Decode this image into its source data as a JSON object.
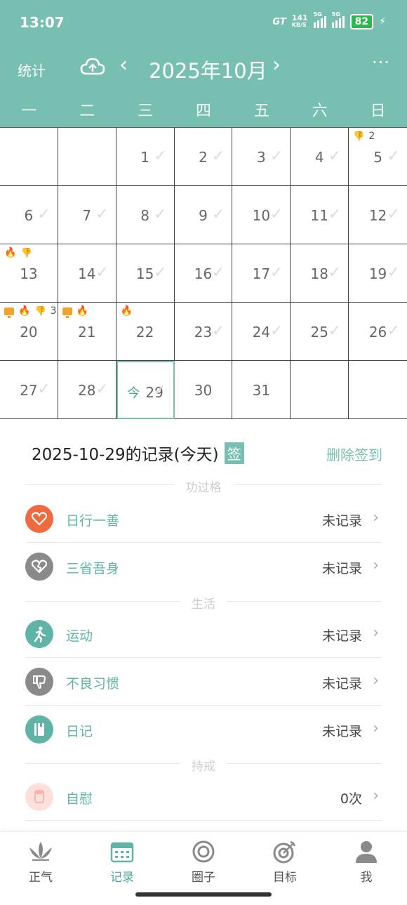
{
  "status_bar": {
    "time": "13:07",
    "carrier": "GT",
    "speed": "141",
    "speed_unit": "KB/S",
    "net1": "5G",
    "net2": "5G",
    "battery": "82"
  },
  "nav": {
    "stats_label": "统计",
    "month_title": "2025年10月",
    "prev": "‹",
    "next": "›",
    "more": "···"
  },
  "weekdays": [
    "一",
    "二",
    "三",
    "四",
    "五",
    "六",
    "日"
  ],
  "calendar": {
    "cells": [
      {
        "day": "",
        "check": false
      },
      {
        "day": "",
        "check": false
      },
      {
        "day": "1",
        "check": true
      },
      {
        "day": "2",
        "check": true
      },
      {
        "day": "3",
        "check": true
      },
      {
        "day": "4",
        "check": true
      },
      {
        "day": "5",
        "check": true,
        "markers": [
          "thumb"
        ],
        "count": "2"
      },
      {
        "day": "6",
        "check": true
      },
      {
        "day": "7",
        "check": true
      },
      {
        "day": "8",
        "check": true
      },
      {
        "day": "9",
        "check": true
      },
      {
        "day": "10",
        "check": true
      },
      {
        "day": "11",
        "check": true
      },
      {
        "day": "12",
        "check": true
      },
      {
        "day": "13",
        "check": false,
        "markers": [
          "fire",
          "thumb"
        ]
      },
      {
        "day": "14",
        "check": true
      },
      {
        "day": "15",
        "check": true
      },
      {
        "day": "16",
        "check": true
      },
      {
        "day": "17",
        "check": true
      },
      {
        "day": "18",
        "check": true
      },
      {
        "day": "19",
        "check": true
      },
      {
        "day": "20",
        "check": false,
        "markers": [
          "screen",
          "fire",
          "thumb"
        ],
        "count": "3"
      },
      {
        "day": "21",
        "check": false,
        "markers": [
          "screen",
          "fire"
        ]
      },
      {
        "day": "22",
        "check": false,
        "markers": [
          "fire"
        ]
      },
      {
        "day": "23",
        "check": true
      },
      {
        "day": "24",
        "check": true
      },
      {
        "day": "25",
        "check": true
      },
      {
        "day": "26",
        "check": true
      },
      {
        "day": "27",
        "check": true
      },
      {
        "day": "28",
        "check": true
      },
      {
        "day": "29",
        "check": true,
        "today": true,
        "today_mark": "今"
      },
      {
        "day": "30",
        "check": false
      },
      {
        "day": "31",
        "check": false
      },
      {
        "day": "",
        "check": false
      },
      {
        "day": "",
        "check": false
      }
    ]
  },
  "record": {
    "title": "2025-10-29的记录(今天)",
    "sign_badge": "签",
    "delete_label": "删除签到"
  },
  "sections": [
    {
      "title": "功过格",
      "items": [
        {
          "label": "日行一善",
          "value": "未记录",
          "icon": "heart-icon",
          "color": "#ef6a3e"
        },
        {
          "label": "三省吾身",
          "value": "未记录",
          "icon": "broken-heart-icon",
          "color": "#8a8a8a"
        }
      ]
    },
    {
      "title": "生活",
      "items": [
        {
          "label": "运动",
          "value": "未记录",
          "icon": "running-icon",
          "color": "#5fb4a6"
        },
        {
          "label": "不良习惯",
          "value": "未记录",
          "icon": "thumbs-down-icon",
          "color": "#8a8a8a"
        },
        {
          "label": "日记",
          "value": "未记录",
          "icon": "diary-icon",
          "color": "#5fb4a6"
        }
      ]
    },
    {
      "title": "持戒",
      "items": [
        {
          "label": "自慰",
          "value": "0次",
          "icon": "tissue-icon",
          "color": "#fde0dc"
        }
      ]
    }
  ],
  "tabs": [
    {
      "label": "正气",
      "icon": "lotus-icon",
      "active": false
    },
    {
      "label": "记录",
      "icon": "calendar-icon",
      "active": true
    },
    {
      "label": "圈子",
      "icon": "circle-icon",
      "active": false
    },
    {
      "label": "目标",
      "icon": "target-icon",
      "active": false
    },
    {
      "label": "我",
      "icon": "person-icon",
      "active": false
    }
  ]
}
